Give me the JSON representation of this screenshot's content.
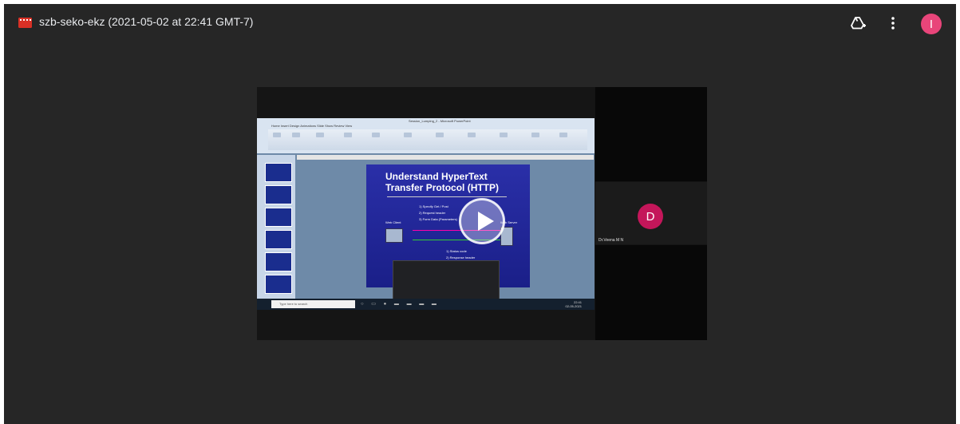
{
  "header": {
    "file_title": "szb-seko-ekz (2021-05-02 at 22:41 GMT-7)",
    "file_icon": "video-file-icon",
    "add_to_drive_icon": "add-to-drive-icon",
    "more_icon": "more-vert-icon",
    "account_initial": "I"
  },
  "colors": {
    "background": "#262626",
    "account_avatar": "#e8457a",
    "participant_avatar": "#c4165a",
    "file_icon": "#d93025"
  },
  "video": {
    "play_icon": "play-icon",
    "participant": {
      "initial": "D",
      "name": "Dr.Veena M N"
    },
    "shared_screen": {
      "window_title": "Session_Lumping_2 - Microsoft PowerPoint",
      "ribbon_tabs": "Home   Insert   Design   Animations   Slide Show   Review   View",
      "slide_title": "Understand HyperText Transfer Protocol (HTTP)",
      "slide_items_request": [
        "1) Specify Get / Post",
        "2) Request header",
        "3) Form Data (Parameters)"
      ],
      "slide_items_response": [
        "1) Status code",
        "2) Response header"
      ],
      "web_client_label": "Web Client",
      "web_server_label": "Web Server",
      "taskbar_search": "Type here to search",
      "taskbar_time": "22:41",
      "taskbar_date": "02-05-2021"
    }
  }
}
